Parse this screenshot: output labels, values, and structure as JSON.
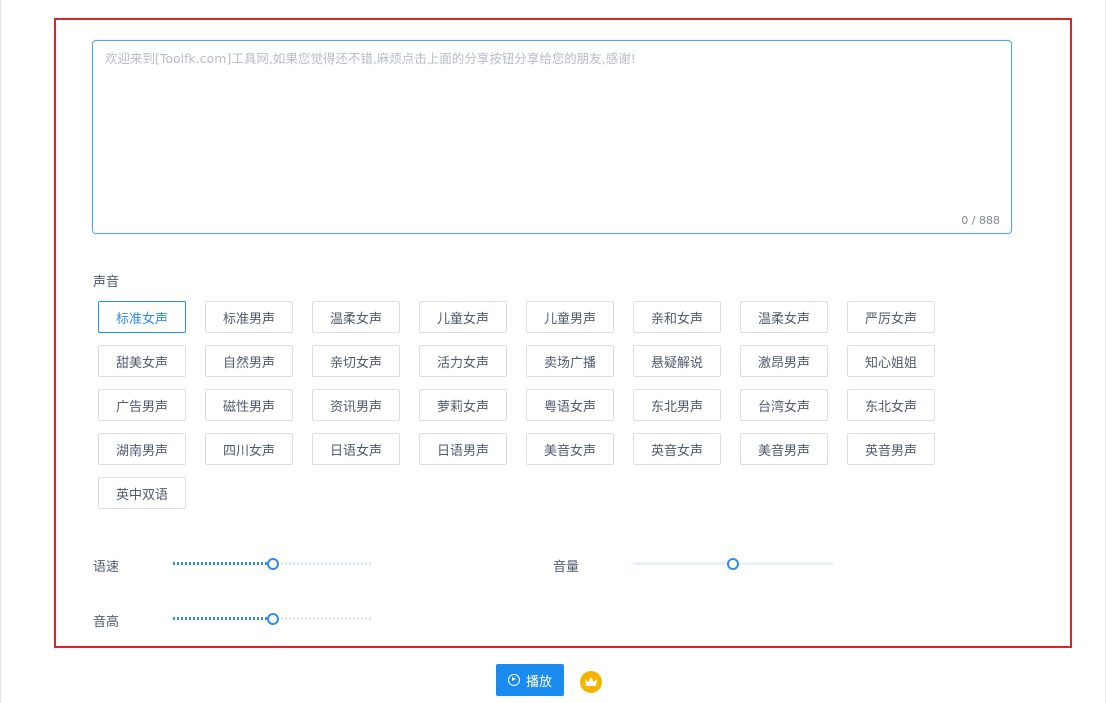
{
  "textarea": {
    "placeholder": "欢迎来到[Toolfk.com]工具网,如果您觉得还不错,麻烦点击上面的分享按钮分享给您的朋友,感谢!",
    "value": "",
    "counter": "0 / 888"
  },
  "voice_section": {
    "label": "声音",
    "selected": "标准女声",
    "options": [
      "标准女声",
      "标准男声",
      "温柔女声",
      "儿童女声",
      "儿童男声",
      "亲和女声",
      "温柔女声",
      "严厉女声",
      "甜美女声",
      "自然男声",
      "亲切女声",
      "活力女声",
      "卖场广播",
      "悬疑解说",
      "激昂男声",
      "知心姐姐",
      "广告男声",
      "磁性男声",
      "资讯男声",
      "萝莉女声",
      "粤语女声",
      "东北男声",
      "台湾女声",
      "东北女声",
      "湖南男声",
      "四川女声",
      "日语女声",
      "日语男声",
      "美音女声",
      "英音女声",
      "美音男声",
      "英音男声",
      "英中双语"
    ]
  },
  "controls": {
    "speed": {
      "label": "语速",
      "value": 0.5
    },
    "volume": {
      "label": "音量",
      "value": 0.5
    },
    "pitch": {
      "label": "音高",
      "value": 0.5
    }
  },
  "play_button": {
    "label": "播放",
    "icon": "play-circle-icon"
  },
  "vip_icon": "crown-icon",
  "colors": {
    "accent": "#2d8cf0",
    "frame": "#d9262c",
    "button": "#1a8cf0",
    "vip": "#f5b400"
  }
}
